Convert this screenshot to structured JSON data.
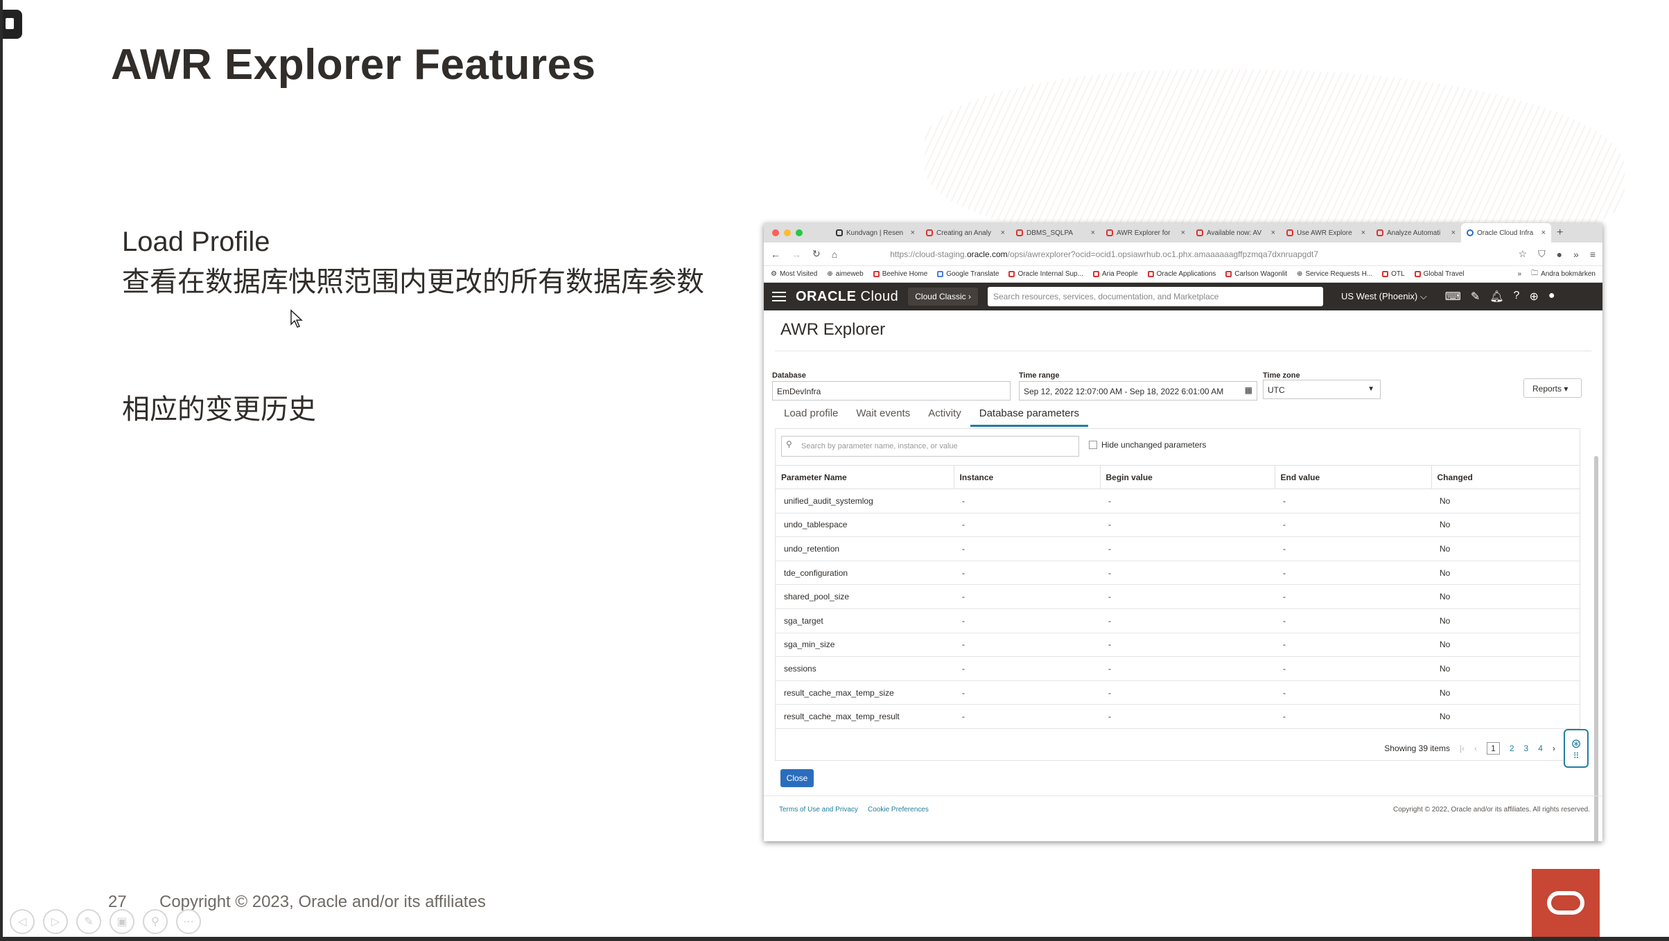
{
  "slide": {
    "title": "AWR Explorer Features",
    "lines1": [
      "Load Profile",
      "查看在数据库快照范围内更改的所有数据库参数"
    ],
    "lines2": [
      "相应的变更历史"
    ],
    "page_number": "27",
    "copyright": "Copyright © 2023, Oracle and/or its affiliates"
  },
  "browser": {
    "tabs": [
      "Kundvagn | Resen",
      "Creating an Analy",
      "DBMS_SQLPA",
      "AWR Explorer for",
      "Available now: AV",
      "Use AWR Explore",
      "Analyze Automati",
      "Oracle Cloud Infra"
    ],
    "active_tab": 7,
    "new_tab": "+",
    "url_prefix": "https://cloud-staging.",
    "url_domain": "oracle.com",
    "url_rest": "/opsi/awrexplorer?ocid=ocid1.opsiawrhub.oc1.phx.amaaaaaagffpzmqa7dxnruapgdt7",
    "bookmarks": [
      "Most Visited",
      "aimeweb",
      "Beehive Home",
      "Google Translate",
      "Oracle Internal Sup...",
      "Aria People",
      "Oracle Applications",
      "Carlson Wagonlit",
      "Service Requests H...",
      "OTL",
      "Global Travel"
    ],
    "bookmarks_more": "»",
    "bookmarks_folder": "Andra bokmärken"
  },
  "console": {
    "brand_strong": "ORACLE",
    "brand_light": " Cloud",
    "cloud_classic": "Cloud Classic ›",
    "search_placeholder": "Search resources, services, documentation, and Marketplace",
    "region": "US West (Phoenix) ⌵"
  },
  "awr": {
    "page_title": "AWR Explorer",
    "database_label": "Database",
    "database_value": "EmDevInfra",
    "time_range_label": "Time range",
    "time_range_value": "Sep 12, 2022 12:07:00 AM - Sep 18, 2022 6:01:00 AM",
    "time_zone_label": "Time zone",
    "time_zone_value": "UTC",
    "reports_label": "Reports ▾",
    "tabs": [
      "Load profile",
      "Wait events",
      "Activity",
      "Database parameters"
    ],
    "active_tab": 3,
    "search_placeholder": "Search by parameter name, instance, or value",
    "hide_unchanged": "Hide unchanged parameters",
    "columns": [
      "Parameter Name",
      "Instance",
      "Begin value",
      "End value",
      "Changed"
    ],
    "rows": [
      [
        "unified_audit_systemlog",
        "-",
        "-",
        "-",
        "No"
      ],
      [
        "undo_tablespace",
        "-",
        "-",
        "-",
        "No"
      ],
      [
        "undo_retention",
        "-",
        "-",
        "-",
        "No"
      ],
      [
        "tde_configuration",
        "-",
        "-",
        "-",
        "No"
      ],
      [
        "shared_pool_size",
        "-",
        "-",
        "-",
        "No"
      ],
      [
        "sga_target",
        "-",
        "-",
        "-",
        "No"
      ],
      [
        "sga_min_size",
        "-",
        "-",
        "-",
        "No"
      ],
      [
        "sessions",
        "-",
        "-",
        "-",
        "No"
      ],
      [
        "result_cache_max_temp_size",
        "-",
        "-",
        "-",
        "No"
      ],
      [
        "result_cache_max_temp_result",
        "-",
        "-",
        "-",
        "No"
      ]
    ],
    "showing": "Showing 39 items",
    "pages": [
      "1",
      "2",
      "3",
      "4"
    ],
    "close_label": "Close",
    "footer_terms": "Terms of Use and Privacy",
    "footer_cookie": "Cookie Preferences",
    "footer_copyright": "Copyright © 2022, Oracle and/or its affiliates. All rights reserved."
  },
  "colors": {
    "oracle_red": "#c74634",
    "console_header": "#312d2a",
    "accent_teal": "#227e9e"
  }
}
